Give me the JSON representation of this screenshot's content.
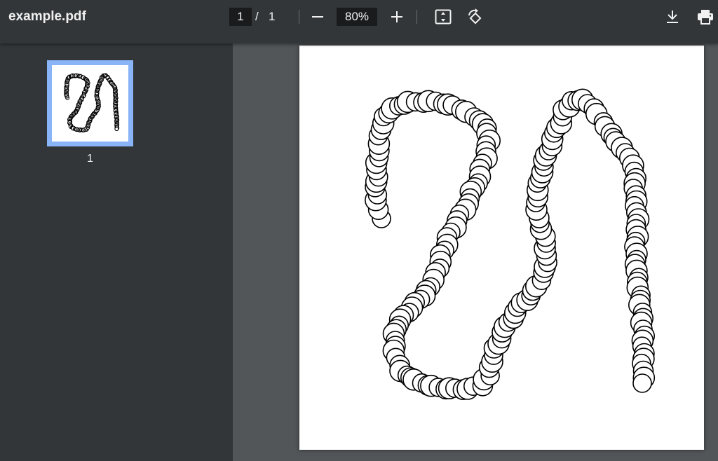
{
  "toolbar": {
    "title": "example.pdf",
    "current_page": "1",
    "page_separator": "/",
    "total_pages": "1",
    "zoom": "80%",
    "icons": [
      "minus-icon",
      "plus-icon",
      "fit-page-icon",
      "rotate-icon",
      "download-icon",
      "print-icon"
    ]
  },
  "sidebar": {
    "thumbnails": [
      {
        "label": "1",
        "selected": true
      }
    ]
  },
  "colors": {
    "toolbar_bg": "#323639",
    "viewer_bg": "#525659",
    "thumb_selected_border": "#8ab4f8",
    "input_bg": "#191b1c"
  }
}
